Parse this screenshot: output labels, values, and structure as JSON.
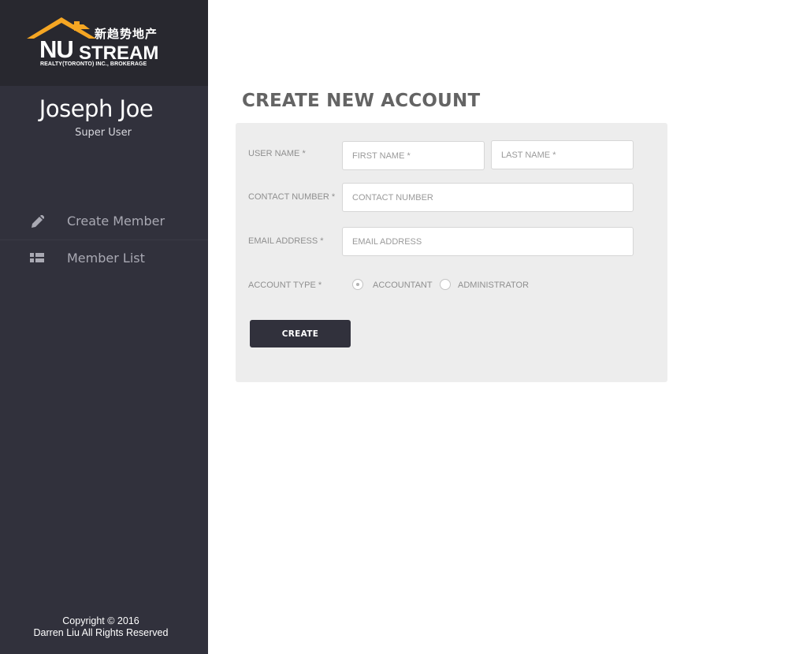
{
  "brand": {
    "logo_text_main": "NU",
    "logo_text_stream": "STREAM",
    "logo_text_chinese": "新趋势地产",
    "logo_subtext": "REALTY(TORONTO) INC., BROKERAGE",
    "accent_color": "#f5a623"
  },
  "user": {
    "name": "Joseph Joe",
    "role": "Super User"
  },
  "sidebar": {
    "items": [
      {
        "label": "Create Member",
        "icon": "pencil-icon"
      },
      {
        "label": "Member List",
        "icon": "list-icon"
      }
    ],
    "copyright_line1": "Copyright © 2016",
    "copyright_line2": "Darren Liu All Rights Reserved",
    "background": "#31313c"
  },
  "form": {
    "title": "CREATE NEW ACCOUNT",
    "username_label": "USER NAME *",
    "first_name_placeholder": "FIRST NAME *",
    "first_name_value": "",
    "last_name_placeholder": "LAST NAME *",
    "last_name_value": "",
    "contact_label": "CONTACT NUMBER *",
    "contact_placeholder": "CONTACT NUMBER",
    "contact_value": "",
    "email_label": "EMAIL ADDRESS *",
    "email_placeholder": "EMAIL ADDRESS",
    "email_value": "",
    "account_type_label": "ACCOUNT TYPE *",
    "account_type_options": [
      "ACCOUNTANT",
      "ADMINISTRATOR"
    ],
    "account_type_selected": "ACCOUNTANT",
    "submit_label": "CREATE"
  }
}
